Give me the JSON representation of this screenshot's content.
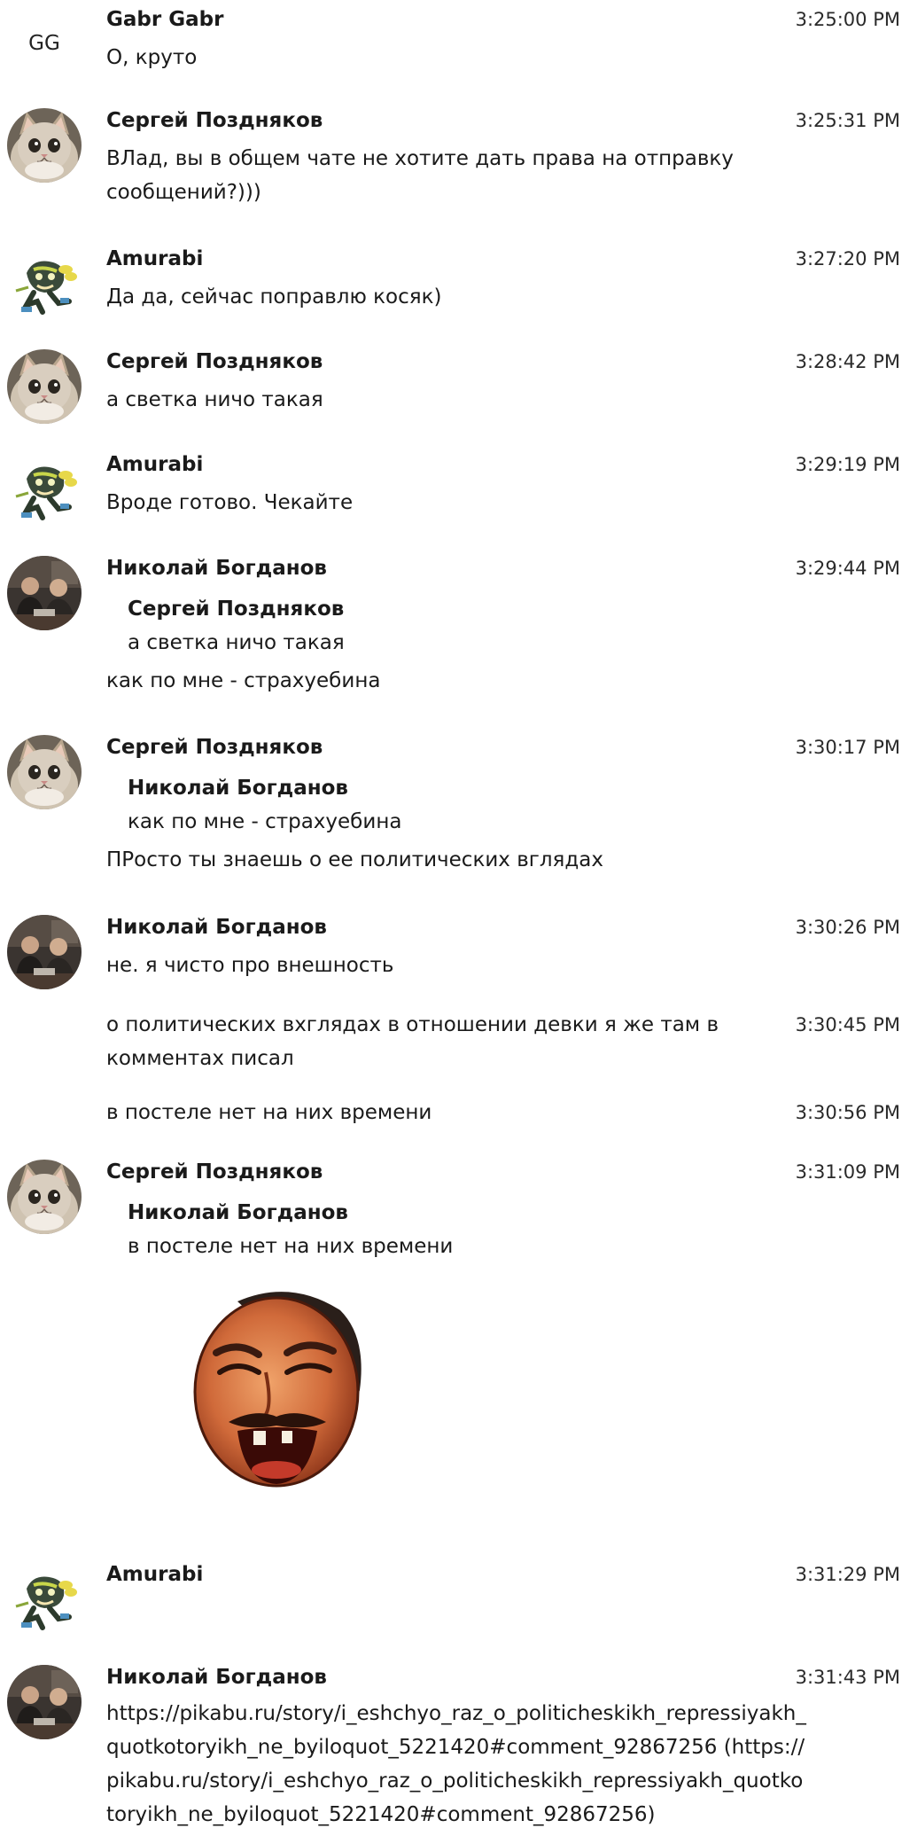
{
  "messages": [
    {
      "initials": "GG",
      "author": "Gabr Gabr",
      "time": "3:25:00 PM",
      "text": "О, круто"
    },
    {
      "author": "Сергей Поздняков",
      "time": "3:25:31 PM",
      "text": "ВЛад, вы в общем чате не хотите дать права на отправку сообщений?)))"
    },
    {
      "author": "Amurabi",
      "time": "3:27:20 PM",
      "text": "Да да, сейчас поправлю косяк)"
    },
    {
      "author": "Сергей Поздняков",
      "time": "3:28:42 PM",
      "text": "а светка ничо такая"
    },
    {
      "author": "Amurabi",
      "time": "3:29:19 PM",
      "text": "Вроде готово. Чекайте"
    },
    {
      "author": "Николай Богданов",
      "time": "3:29:44 PM",
      "quote_author": "Сергей Поздняков",
      "quote_text": "а светка ничо такая",
      "text": "как по мне - страхуебина"
    },
    {
      "author": "Сергей Поздняков",
      "time": "3:30:17 PM",
      "quote_author": "Николай Богданов",
      "quote_text": "как по мне - страхуебина",
      "text": "ПРосто ты знаешь о ее политических вглядах"
    },
    {
      "author": "Николай Богданов",
      "time": "3:30:26 PM",
      "text": "не. я чисто про внешность"
    },
    {
      "time": "3:30:45 PM",
      "text": "о политических вхглядах в отношении девки я же там в комментах писал"
    },
    {
      "time": "3:30:56 PM",
      "text": "в постеле нет на них времени"
    },
    {
      "author": "Сергей Поздняков",
      "time": "3:31:09 PM",
      "quote_author": "Николай Богданов",
      "quote_text": "в постеле нет на них времени"
    },
    {
      "author": "Amurabi",
      "time": "3:31:29 PM"
    },
    {
      "author": "Николай Богданов",
      "time": "3:31:43 PM",
      "text": "https://pikabu.ru/story/i_eshchyo_raz_o_politicheskikh_repressiyakh_quotkotoryikh_ne_byiloquot_5221420#comment_92867256 (https://pikabu.ru/story/i_eshchyo_raz_o_politicheskikh_repressiyakh_quotkotoryikh_ne_byiloquot_5221420#comment_92867256)"
    }
  ],
  "icons": {
    "cat": "cat-avatar-icon",
    "ninja": "ninja-avatar-icon",
    "photo": "people-photo-avatar-icon",
    "sticker": "laughing-man-sticker"
  }
}
